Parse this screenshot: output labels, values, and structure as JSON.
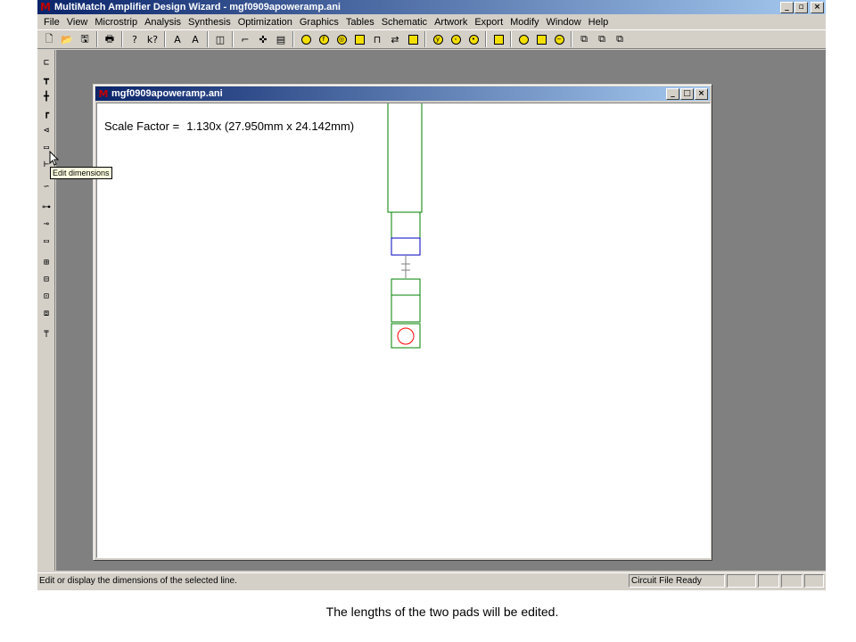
{
  "window": {
    "title": "MultiMatch Amplifier Design Wizard - mgf0909apoweramp.ani",
    "app_icon": "multimatch-logo-icon",
    "controls": {
      "minimize": "_",
      "maximize": "▫",
      "close": "×"
    }
  },
  "menubar": {
    "items": [
      "File",
      "View",
      "Microstrip",
      "Analysis",
      "Synthesis",
      "Optimization",
      "Graphics",
      "Tables",
      "Schematic",
      "Artwork",
      "Export",
      "Modify",
      "Window",
      "Help"
    ]
  },
  "toolbar": {
    "groups": [
      [
        "new-file-icon",
        "open-folder-icon",
        "save-icon"
      ],
      [
        "print-icon"
      ],
      [
        "help-icon",
        "context-help-icon"
      ],
      [
        "text-a-icon",
        "text-a-alt-icon"
      ],
      [
        "dimension-icon"
      ],
      [
        "line-tool-icon",
        "cross-tool-icon",
        "box-tool-icon"
      ],
      [
        "yellow-circle-icon",
        "yellow-f-icon",
        "yellow-target-icon",
        "yellow-x-icon",
        "component-icon",
        "swap-icon",
        "shape-icon"
      ],
      [
        "yellow-y-icon",
        "yellow-arrow-icon",
        "yellow-dot-icon"
      ],
      [
        "pulse-icon"
      ],
      [
        "ring-icon",
        "square-icon",
        "minus-circle-icon"
      ],
      [
        "layer-a-icon",
        "layer-b-icon",
        "layer-c-icon"
      ]
    ]
  },
  "vtoolbar": {
    "items": [
      "step-icon",
      "tee-icon",
      "cross-junction-icon",
      "bend-icon",
      "taper-icon",
      "edit-dimensions-icon",
      "line-end-icon",
      "open-stub-icon",
      "coupled-line-icon",
      "via-icon",
      "pad-icon",
      "zoom-in-icon",
      "zoom-out-icon",
      "zoom-fit-icon",
      "zoom-window-icon",
      "antenna-icon"
    ]
  },
  "tooltip": {
    "text": "Edit dimensions"
  },
  "child_window": {
    "title": "mgf0909apoweramp.ani",
    "controls": {
      "minimize": "_",
      "maximize": "□",
      "close": "×"
    },
    "scale_label": "Scale Factor =",
    "scale_value": "1.130x (27.950mm x 24.142mm)"
  },
  "statusbar": {
    "message": "Edit or display the dimensions of the selected line.",
    "file_state": "Circuit File Ready",
    "cells": [
      "",
      "",
      "",
      ""
    ]
  },
  "colors": {
    "green_line": "#008000",
    "blue_line": "#0000c0",
    "red_circle": "#ff0000"
  },
  "caption": "The lengths of the two pads will be edited."
}
